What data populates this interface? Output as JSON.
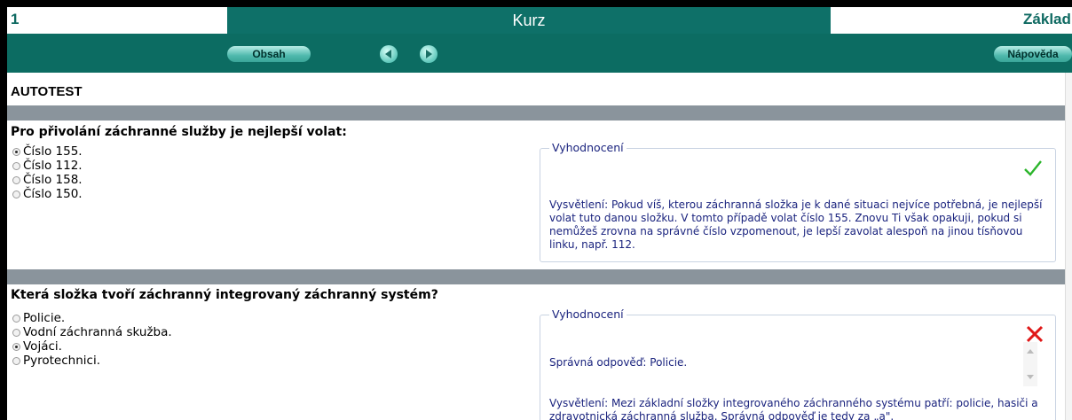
{
  "titlebar": {
    "page_number": "1",
    "course_title": "Kurz",
    "section": "Základní"
  },
  "toolbar": {
    "contents_label": "Obsah",
    "help_label": "Nápověda"
  },
  "page": {
    "heading": "AUTOTEST"
  },
  "questions": [
    {
      "text": "Pro přivolání záchranné služby je nejlepší volat:",
      "options": [
        "Číslo 155.",
        "Číslo 112.",
        "Číslo 158.",
        "Číslo 150."
      ],
      "selected_index": 0,
      "result": "correct",
      "evaluation_label": "Vyhodnocení",
      "explanation": "Vysvětlení: Pokud víš, kterou záchranná složka je k dané situaci nejvíce potřebná, je nejlepší volat tuto danou složku. V tomto případě volat číslo 155. Znovu Ti však opakuji, pokud si nemůžeš zrovna na správné číslo vzpomenout, je lepší zavolat alespoň na jinou tísňovou linku, např. 112."
    },
    {
      "text": "Která složka tvoří záchranný integrovaný záchranný systém?",
      "options": [
        "Policie.",
        "Vodní záchranná skužba.",
        "Vojáci.",
        "Pyrotechnici."
      ],
      "selected_index": 2,
      "result": "incorrect",
      "evaluation_label": "Vyhodnocení",
      "correct_answer": "Správná odpověď: Policie.",
      "explanation": "Vysvětlení: Mezi základní složky integrovaného záchranného systému patří: policie, hasiči a zdravotnická záchranná služba. Správná odpověď je tedy za „a\"."
    }
  ],
  "colors": {
    "accent": "#0e7068",
    "bar": "#8a949c",
    "text_blue": "#1a237e",
    "check": "#2bb52b",
    "cross": "#e01818"
  }
}
